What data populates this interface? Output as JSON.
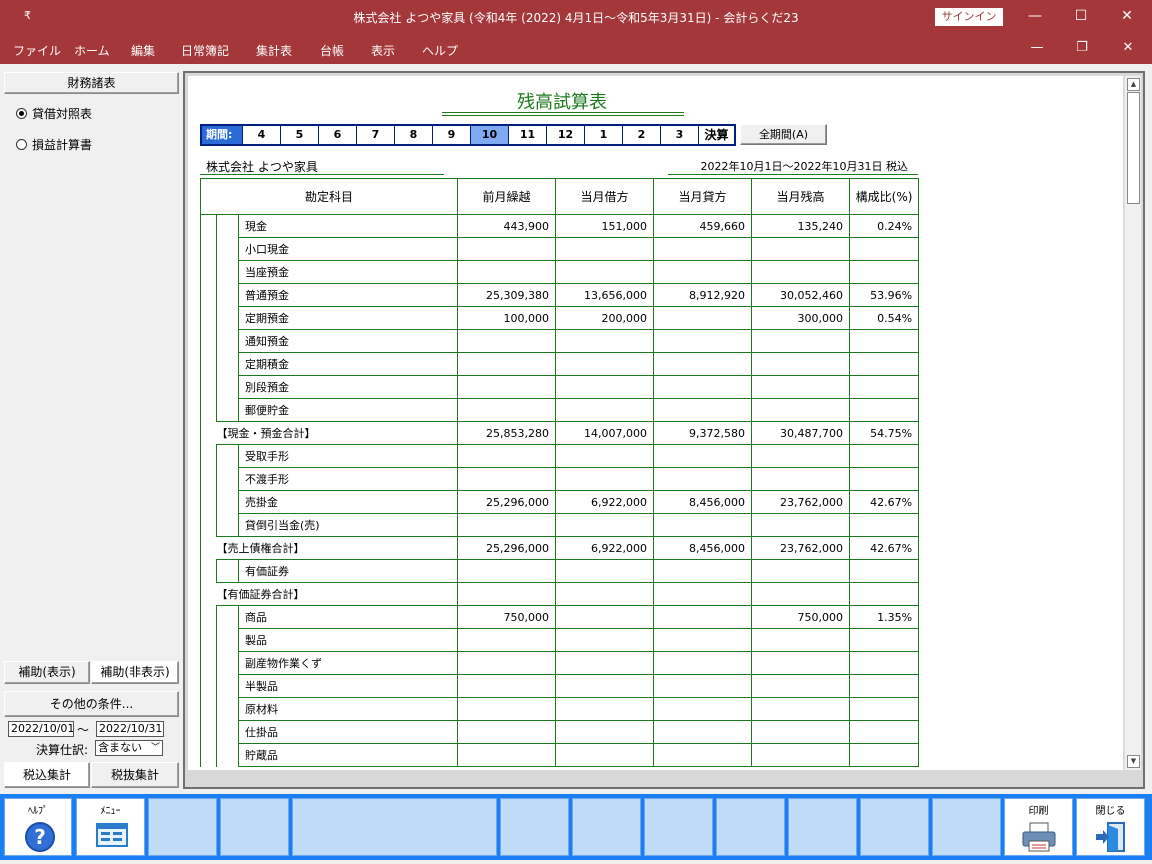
{
  "window": {
    "quick_access": "₹",
    "title": "株式会社 よつや家具 (令和4年 (2022) 4月1日～令和5年3月31日)  -  会計らくだ23",
    "signin_label": "サインイン",
    "minimize": "—",
    "maximize": "☐",
    "close": "✕"
  },
  "menu": {
    "items": [
      "ファイル",
      "ホーム",
      "編集",
      "日常簿記",
      "集計表",
      "台帳",
      "表示",
      "ヘルプ"
    ],
    "restore": "❐"
  },
  "left": {
    "header": "財務諸表",
    "radios": [
      {
        "label": "貸借対照表",
        "checked": true
      },
      {
        "label": "損益計算書",
        "checked": false
      }
    ],
    "tabs": [
      "補助(表示)",
      "補助(非表示)"
    ],
    "other_conditions": "その他の条件...",
    "date_from": "2022/10/01",
    "date_sep": "～",
    "date_to": "2022/10/31",
    "settlement_label": "決算仕訳:",
    "settlement_value": "含まない",
    "tax_tabs": [
      "税込集計",
      "税抜集計"
    ]
  },
  "report": {
    "title": "残高試算表",
    "period_label": "期間:",
    "months": [
      "4",
      "5",
      "6",
      "7",
      "8",
      "9",
      "10",
      "11",
      "12",
      "1",
      "2",
      "3"
    ],
    "selected_month": "10",
    "kessan": "決算",
    "all_period_button": "全期間(A)",
    "company": "株式会社 よつや家具",
    "period_text": "2022年10月1日～2022年10月31日  税込",
    "columns": [
      "勘定科目",
      "前月繰越",
      "当月借方",
      "当月貸方",
      "当月残高",
      "構成比(%)"
    ],
    "rows": [
      {
        "name": "現金",
        "sum": false,
        "prev": "443,900",
        "debit": "151,000",
        "credit": "459,660",
        "balance": "135,240",
        "ratio": "0.24%"
      },
      {
        "name": "小口現金",
        "sum": false,
        "prev": "",
        "debit": "",
        "credit": "",
        "balance": "",
        "ratio": ""
      },
      {
        "name": "当座預金",
        "sum": false,
        "prev": "",
        "debit": "",
        "credit": "",
        "balance": "",
        "ratio": ""
      },
      {
        "name": "普通預金",
        "sum": false,
        "prev": "25,309,380",
        "debit": "13,656,000",
        "credit": "8,912,920",
        "balance": "30,052,460",
        "ratio": "53.96%"
      },
      {
        "name": "定期預金",
        "sum": false,
        "prev": "100,000",
        "debit": "200,000",
        "credit": "",
        "balance": "300,000",
        "ratio": "0.54%"
      },
      {
        "name": "通知預金",
        "sum": false,
        "prev": "",
        "debit": "",
        "credit": "",
        "balance": "",
        "ratio": ""
      },
      {
        "name": "定期積金",
        "sum": false,
        "prev": "",
        "debit": "",
        "credit": "",
        "balance": "",
        "ratio": ""
      },
      {
        "name": "別段預金",
        "sum": false,
        "prev": "",
        "debit": "",
        "credit": "",
        "balance": "",
        "ratio": ""
      },
      {
        "name": "郵便貯金",
        "sum": false,
        "prev": "",
        "debit": "",
        "credit": "",
        "balance": "",
        "ratio": ""
      },
      {
        "name": "【現金・預金合計】",
        "sum": true,
        "prev": "25,853,280",
        "debit": "14,007,000",
        "credit": "9,372,580",
        "balance": "30,487,700",
        "ratio": "54.75%"
      },
      {
        "name": "受取手形",
        "sum": false,
        "prev": "",
        "debit": "",
        "credit": "",
        "balance": "",
        "ratio": ""
      },
      {
        "name": "不渡手形",
        "sum": false,
        "prev": "",
        "debit": "",
        "credit": "",
        "balance": "",
        "ratio": ""
      },
      {
        "name": "売掛金",
        "sum": false,
        "prev": "25,296,000",
        "debit": "6,922,000",
        "credit": "8,456,000",
        "balance": "23,762,000",
        "ratio": "42.67%"
      },
      {
        "name": "貸倒引当金(売)",
        "sum": false,
        "prev": "",
        "debit": "",
        "credit": "",
        "balance": "",
        "ratio": ""
      },
      {
        "name": "【売上債権合計】",
        "sum": true,
        "prev": "25,296,000",
        "debit": "6,922,000",
        "credit": "8,456,000",
        "balance": "23,762,000",
        "ratio": "42.67%"
      },
      {
        "name": "有価証券",
        "sum": false,
        "prev": "",
        "debit": "",
        "credit": "",
        "balance": "",
        "ratio": ""
      },
      {
        "name": "【有価証券合計】",
        "sum": true,
        "prev": "",
        "debit": "",
        "credit": "",
        "balance": "",
        "ratio": ""
      },
      {
        "name": "商品",
        "sum": false,
        "prev": "750,000",
        "debit": "",
        "credit": "",
        "balance": "750,000",
        "ratio": "1.35%"
      },
      {
        "name": "製品",
        "sum": false,
        "prev": "",
        "debit": "",
        "credit": "",
        "balance": "",
        "ratio": ""
      },
      {
        "name": "副産物作業くず",
        "sum": false,
        "prev": "",
        "debit": "",
        "credit": "",
        "balance": "",
        "ratio": ""
      },
      {
        "name": "半製品",
        "sum": false,
        "prev": "",
        "debit": "",
        "credit": "",
        "balance": "",
        "ratio": ""
      },
      {
        "name": "原材料",
        "sum": false,
        "prev": "",
        "debit": "",
        "credit": "",
        "balance": "",
        "ratio": ""
      },
      {
        "name": "仕掛品",
        "sum": false,
        "prev": "",
        "debit": "",
        "credit": "",
        "balance": "",
        "ratio": ""
      },
      {
        "name": "貯蔵品",
        "sum": false,
        "prev": "",
        "debit": "",
        "credit": "",
        "balance": "",
        "ratio": ""
      }
    ]
  },
  "toolbar": {
    "help_label": "ﾍﾙﾌﾟ",
    "menu_label": "ﾒﾆｭｰ",
    "print_label": "印刷",
    "close_label": "閉じる",
    "help_icon": "question-circle-icon",
    "menu_icon": "menu-screen-icon",
    "print_icon": "printer-icon",
    "close_icon": "exit-door-icon"
  }
}
